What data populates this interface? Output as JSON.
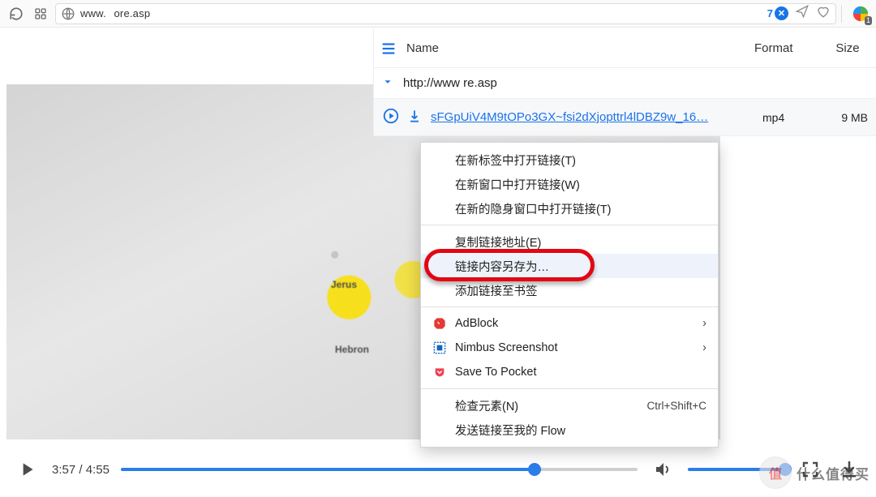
{
  "toolbar": {
    "url_prefix": "www.",
    "url_suffix": "ore.asp",
    "download_count": "7",
    "download_badge_glyph": "✕",
    "ext_badge": "1"
  },
  "dl_panel": {
    "col_name": "Name",
    "col_format": "Format",
    "col_size": "Size",
    "group_label": "http://www                                  ﻿re.asp",
    "file_label": "sFGpUiV4M9tOPo3GX~fsi2dXjopttrl4lDBZ9w_16…",
    "file_format": "mp4",
    "file_size": "9 MB"
  },
  "ctx": {
    "items": [
      "在新标签中打开链接(T)",
      "在新窗口中打开链接(W)",
      "在新的隐身窗口中打开链接(T)",
      "复制链接地址(E)",
      "链接内容另存为…",
      "添加链接至书签",
      "AdBlock",
      "Nimbus Screenshot",
      "Save To Pocket",
      "检查元素(N)",
      "发送链接至我的 Flow"
    ],
    "shortcut_inspect": "Ctrl+Shift+C"
  },
  "player": {
    "current": "3:57",
    "total": "4:55",
    "progress_pct": 80,
    "volume_pct": 100
  },
  "watermark": {
    "circle": "值",
    "text": "什么值得买"
  },
  "map_labels": {
    "jerusalem": "Jerus",
    "hebron": "Hebron"
  }
}
